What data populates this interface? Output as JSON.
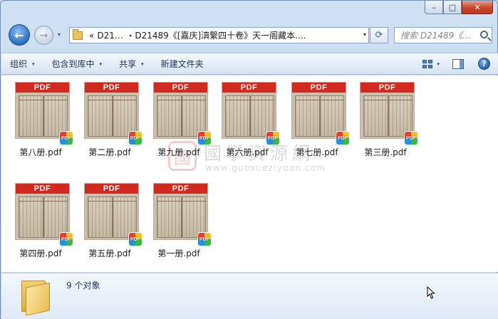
{
  "window": {
    "caption_buttons": {
      "minimize": "–",
      "maximize": "□",
      "close": "✕"
    }
  },
  "nav": {
    "back_glyph": "←",
    "forward_glyph": "→",
    "history_glyph": "▾",
    "address": {
      "overflow": "«",
      "segments": [
        "D21…",
        "D21489《[嘉庆]滇繫四十卷》天一阁藏本...."
      ],
      "separator": "▸",
      "dropdown_glyph": "▾"
    },
    "refresh_glyph": "⟳",
    "search_placeholder": "搜索 D21489《..."
  },
  "toolbar": {
    "items": [
      {
        "label": "组织",
        "has_arrow": true
      },
      {
        "label": "包含到库中",
        "has_arrow": true
      },
      {
        "label": "共享",
        "has_arrow": true
      },
      {
        "label": "新建文件夹",
        "has_arrow": false
      }
    ],
    "arrow_glyph": "▾",
    "view_arrow_glyph": "▾",
    "help_glyph": "?"
  },
  "files": [
    {
      "name": "第八册.pdf"
    },
    {
      "name": "第二册.pdf"
    },
    {
      "name": "第九册.pdf"
    },
    {
      "name": "第六册.pdf"
    },
    {
      "name": "第七册.pdf"
    },
    {
      "name": "第三册.pdf"
    },
    {
      "name": "第四册.pdf"
    },
    {
      "name": "第五册.pdf"
    },
    {
      "name": "第一册.pdf"
    }
  ],
  "thumb_band_text": "PDF",
  "badge_text": "PDF",
  "watermark": {
    "seal": "國",
    "title": "國學資源網",
    "url": "www.guoxueziyuan.com"
  },
  "status": {
    "item_count": "9 个对象"
  },
  "colors": {
    "pdf_band": "#d22a1f",
    "window_frame": "#c3d7ee",
    "close_button": "#c8442a"
  }
}
